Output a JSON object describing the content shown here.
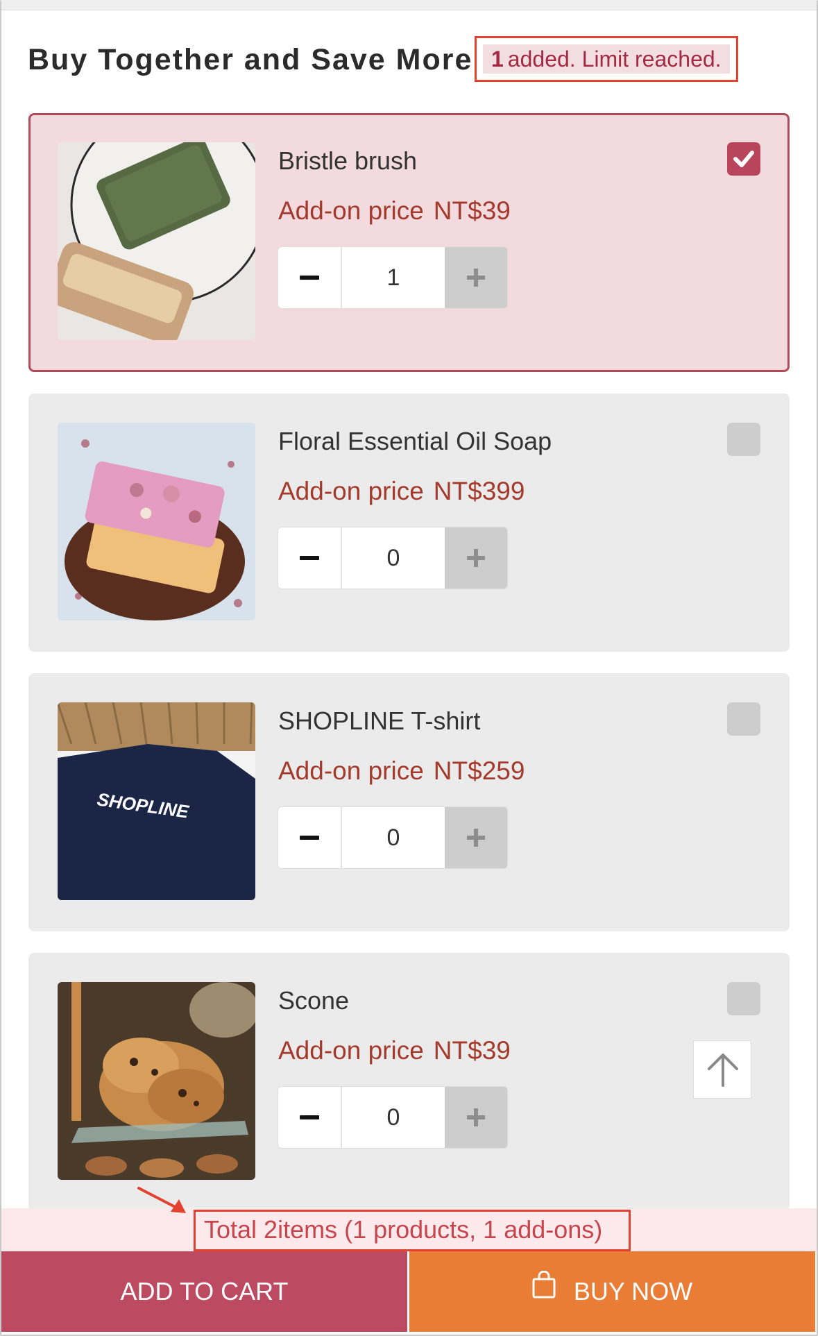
{
  "header": {
    "title": "Buy Together and Save More",
    "limit_count": "1",
    "limit_text": "added. Limit reached."
  },
  "products": [
    {
      "name": "Bristle brush",
      "price_label": "Add-on price",
      "price": "NT$39",
      "qty": "1",
      "selected": true,
      "image_icon": "soap-and-brush-photo"
    },
    {
      "name": "Floral Essential Oil Soap",
      "price_label": "Add-on price",
      "price": "NT$399",
      "qty": "0",
      "selected": false,
      "image_icon": "floral-soap-photo"
    },
    {
      "name": "SHOPLINE T-shirt",
      "price_label": "Add-on price",
      "price": "NT$259",
      "qty": "0",
      "selected": false,
      "image_icon": "tshirt-photo"
    },
    {
      "name": "Scone",
      "price_label": "Add-on price",
      "price": "NT$39",
      "qty": "0",
      "selected": false,
      "image_icon": "scone-photo"
    }
  ],
  "tshirt_logo_text": "SHOPLINE",
  "summary": {
    "text": "Total 2items (1 products, 1 add-ons)"
  },
  "actions": {
    "add_to_cart": "ADD TO CART",
    "buy_now": "BUY NOW"
  },
  "colors": {
    "accent": "#bc4a61",
    "buy": "#e97d36",
    "price": "#a33a2c",
    "highlight_border": "#e2422f"
  }
}
